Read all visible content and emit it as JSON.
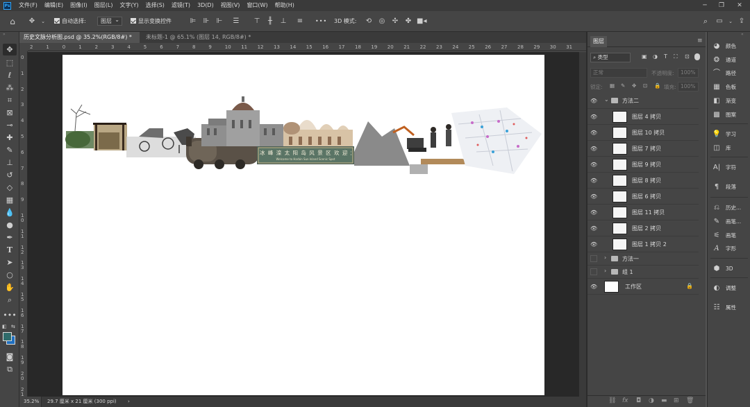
{
  "app": {
    "logo": "Ps",
    "menus": [
      "文件(F)",
      "编辑(E)",
      "图像(I)",
      "图层(L)",
      "文字(Y)",
      "选择(S)",
      "滤镜(T)",
      "3D(D)",
      "视图(V)",
      "窗口(W)",
      "帮助(H)"
    ],
    "window_controls": [
      "minimize-icon",
      "restore-icon",
      "close-icon"
    ]
  },
  "options_bar": {
    "auto_select_label": "自动选择:",
    "auto_select_target": "图层",
    "show_transform_label": "显示变换控件",
    "more_label": "•••",
    "mode_3d_label": "3D 模式:"
  },
  "tabs": [
    {
      "label": "历史文脉分析图.psd @ 35.2%(RGB/8#) *",
      "close": "×",
      "active": true
    },
    {
      "label": "未标题-1 @ 65.1% (图层 14, RGB/8#) *",
      "close": "×",
      "active": false
    }
  ],
  "ruler": {
    "top": [
      "2",
      "1",
      "0",
      "1",
      "2",
      "3",
      "4",
      "5",
      "6",
      "7",
      "8",
      "9",
      "10",
      "11",
      "12",
      "13",
      "14",
      "15",
      "16",
      "17",
      "18",
      "19",
      "20",
      "21",
      "22",
      "23",
      "24",
      "25",
      "26",
      "27",
      "28",
      "29",
      "30",
      "31"
    ],
    "left": [
      "0",
      "1",
      "2",
      "3",
      "4",
      "5",
      "6",
      "7",
      "8",
      "9",
      "1 0",
      "1 1",
      "1 2",
      "1 3",
      "1 4",
      "1 5",
      "1 6",
      "1 7",
      "1 8",
      "1 9",
      "2 0",
      "2 1"
    ]
  },
  "status": {
    "zoom": "35.2%",
    "doc_info": "29.7 厘米 x 21 厘米 (300 ppi)",
    "arrow": "›"
  },
  "canvas": {
    "banner_sign_cn": "冰 峰 滦 太 阳 岛 风 景 区 欢 迎 您",
    "banner_sign_en": "Welcome to Harbin Sun Island Scenic Spot"
  },
  "layers_panel": {
    "title": "图层",
    "filter_kind": "类型",
    "blend_mode": "正常",
    "opacity_label": "不透明度:",
    "opacity_value": "100%",
    "lock_label": "锁定:",
    "fill_label": "填充:",
    "fill_value": "100%",
    "layers": [
      {
        "name": "方法二",
        "type": "group",
        "visible": true,
        "expanded": true
      },
      {
        "name": "图层 4 拷贝",
        "type": "layer",
        "visible": true
      },
      {
        "name": "图层 10 拷贝",
        "type": "layer",
        "visible": true
      },
      {
        "name": "图层 7 拷贝",
        "type": "layer",
        "visible": true
      },
      {
        "name": "图层 9 拷贝",
        "type": "layer",
        "visible": true
      },
      {
        "name": "图层 8 拷贝",
        "type": "layer",
        "visible": true
      },
      {
        "name": "图层 6 拷贝",
        "type": "layer",
        "visible": true
      },
      {
        "name": "图层 11 拷贝",
        "type": "layer",
        "visible": true
      },
      {
        "name": "图层 2 拷贝",
        "type": "layer",
        "visible": true
      },
      {
        "name": "图层 1 拷贝 2",
        "type": "layer",
        "visible": true
      },
      {
        "name": "方法一",
        "type": "group",
        "visible": false,
        "expanded": false
      },
      {
        "name": "组 1",
        "type": "group",
        "visible": false,
        "expanded": false
      },
      {
        "name": "工作区",
        "type": "artboard",
        "visible": true,
        "locked": true
      }
    ],
    "footer_icons": [
      "link-icon",
      "fx-icon",
      "mask-icon",
      "adjustment-icon",
      "folder-icon",
      "new-layer-icon",
      "trash-icon"
    ]
  },
  "right_dock": [
    {
      "label": "颜色",
      "icon": "color-icon"
    },
    {
      "label": "通道",
      "icon": "channels-icon"
    },
    {
      "label": "路径",
      "icon": "paths-icon"
    },
    {
      "label": "色板",
      "icon": "swatches-icon"
    },
    {
      "label": "渐变",
      "icon": "gradient-icon"
    },
    {
      "label": "图案",
      "icon": "patterns-icon"
    },
    {
      "label": "学习",
      "icon": "learn-icon"
    },
    {
      "label": "库",
      "icon": "libraries-icon"
    },
    {
      "label": "字符",
      "icon": "character-icon"
    },
    {
      "label": "段落",
      "icon": "paragraph-icon"
    },
    {
      "label": "历史...",
      "icon": "history-icon"
    },
    {
      "label": "画笔...",
      "icon": "brush-settings-icon"
    },
    {
      "label": "画笔",
      "icon": "brushes-icon"
    },
    {
      "label": "字形",
      "icon": "glyphs-icon"
    },
    {
      "label": "3D",
      "icon": "3d-icon"
    },
    {
      "label": "调整",
      "icon": "adjustments-icon"
    },
    {
      "label": "属性",
      "icon": "properties-icon"
    }
  ],
  "colors": {
    "foreground": "#2f6b6a",
    "background": "#1f6fbf",
    "accent": "#31a8ff"
  }
}
